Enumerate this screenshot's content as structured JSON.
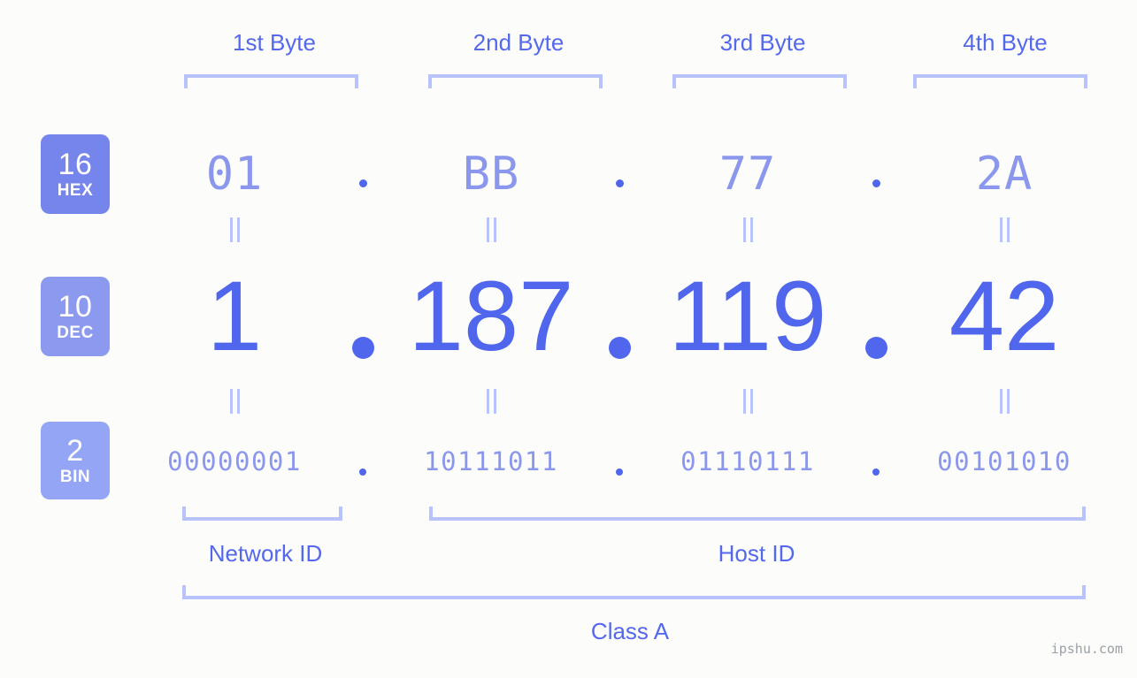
{
  "background_color": "#fcfdfa",
  "accent_color": "#5468ee",
  "muted_accent_color": "#8b97ec",
  "bracket_color": "#b8c2fb",
  "byte_headers": [
    {
      "label": "1st Byte"
    },
    {
      "label": "2nd Byte"
    },
    {
      "label": "3rd Byte"
    },
    {
      "label": "4th Byte"
    }
  ],
  "radix_badges": [
    {
      "base": "16",
      "name": "HEX",
      "color": "#7585ec"
    },
    {
      "base": "10",
      "name": "DEC",
      "color": "#8b9aef"
    },
    {
      "base": "2",
      "name": "BIN",
      "color": "#93a5f4"
    }
  ],
  "separator": ".",
  "equals_symbol": "=",
  "rows": {
    "hex": {
      "radix": "HEX",
      "values": [
        "01",
        "BB",
        "77",
        "2A"
      ]
    },
    "dec": {
      "radix": "DEC",
      "values": [
        "1",
        "187",
        "119",
        "42"
      ]
    },
    "bin": {
      "radix": "BIN",
      "values": [
        "00000001",
        "10111011",
        "01110111",
        "00101010"
      ]
    }
  },
  "sections": {
    "network_id": "Network ID",
    "host_id": "Host ID",
    "class": "Class A"
  },
  "watermark": "ipshu.com"
}
